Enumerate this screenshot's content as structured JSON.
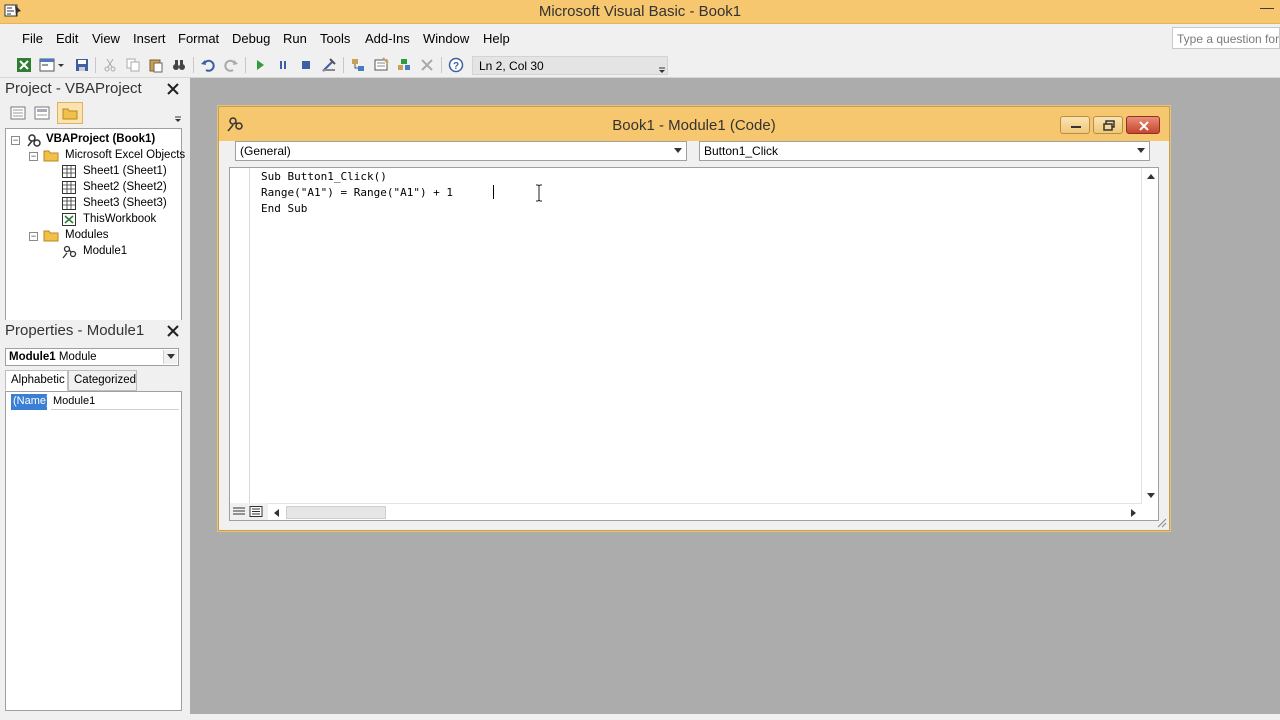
{
  "window": {
    "title": "Microsoft Visual Basic - Book1"
  },
  "menu": {
    "items": [
      "File",
      "Edit",
      "View",
      "Insert",
      "Format",
      "Debug",
      "Run",
      "Tools",
      "Add-Ins",
      "Window",
      "Help"
    ],
    "question_placeholder": "Type a question for"
  },
  "toolbar": {
    "cursor_position": "Ln 2, Col 30"
  },
  "project_panel": {
    "title": "Project - VBAProject",
    "tree": {
      "root": "VBAProject (Book1)",
      "excel_objects": "Microsoft Excel Objects",
      "sheet1": "Sheet1 (Sheet1)",
      "sheet2": "Sheet2 (Sheet2)",
      "sheet3": "Sheet3 (Sheet3)",
      "this_workbook": "ThisWorkbook",
      "modules": "Modules",
      "module1": "Module1"
    }
  },
  "properties_panel": {
    "title": "Properties - Module1",
    "object_name": "Module1",
    "object_type": "Module",
    "tabs": [
      "Alphabetic",
      "Categorized"
    ],
    "property_name": "(Name)",
    "property_value": "Module1"
  },
  "code_window": {
    "title": "Book1 - Module1 (Code)",
    "object_combo": "(General)",
    "procedure_combo": "Button1_Click",
    "code_lines": [
      "Sub Button1_Click()",
      "Range(\"A1\") = Range(\"A1\") + 1",
      "End Sub"
    ]
  },
  "colors": {
    "title_bar": "#f6c76f",
    "mdi_background": "#acacac",
    "selection": "#3b7fd4"
  }
}
